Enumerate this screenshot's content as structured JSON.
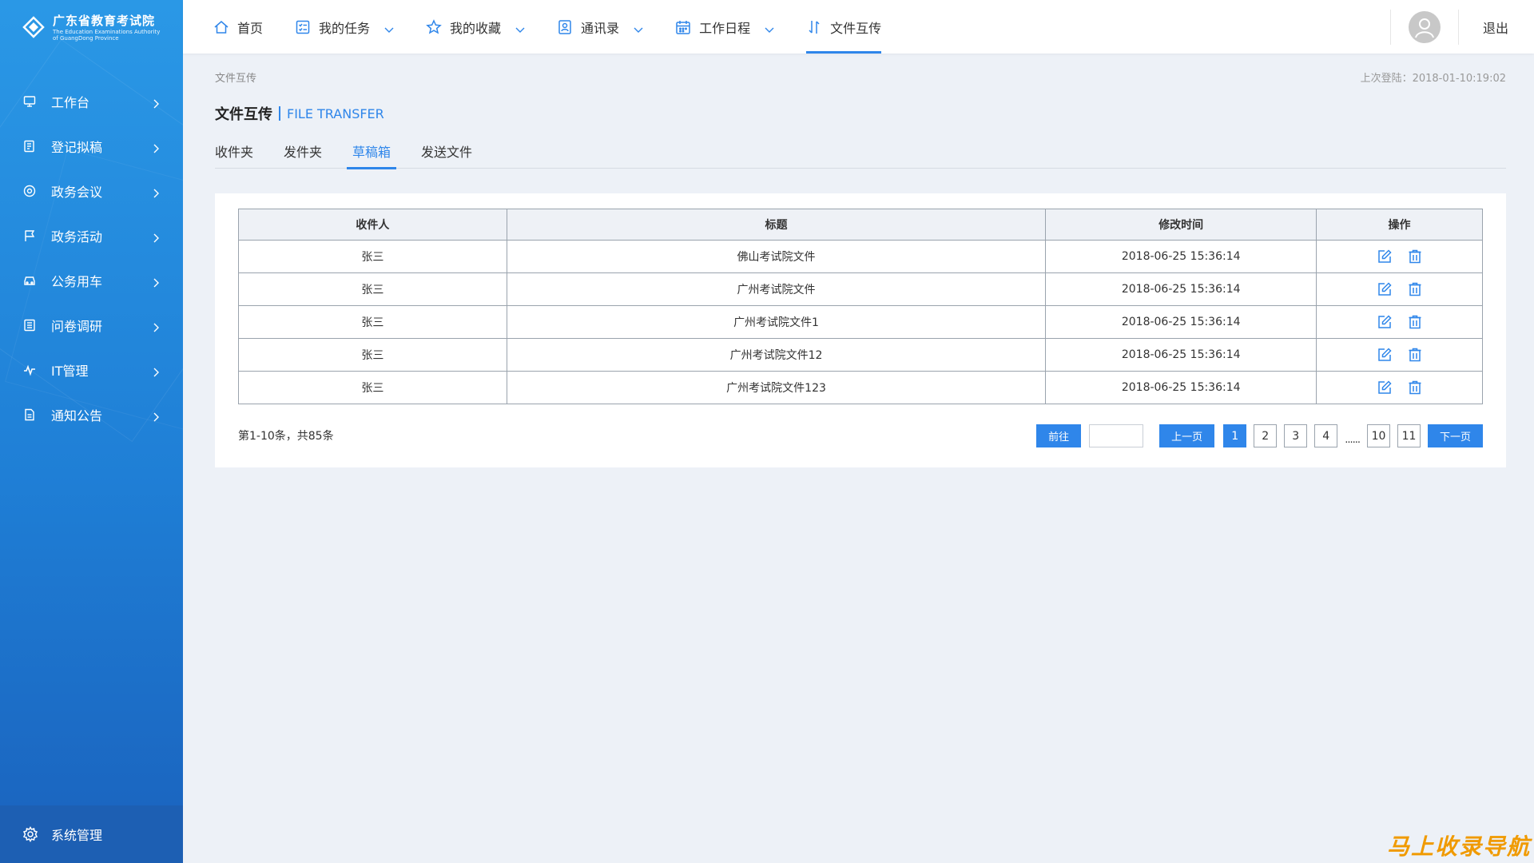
{
  "app": {
    "org_name_cn": "广东省教育考试院",
    "org_name_en": "The Education Examinations Authority of GuangDong Province"
  },
  "sidebar": {
    "items": [
      {
        "label": "工作台",
        "icon": "monitor-icon"
      },
      {
        "label": "登记拟稿",
        "icon": "edit-doc-icon"
      },
      {
        "label": "政务会议",
        "icon": "target-icon"
      },
      {
        "label": "政务活动",
        "icon": "flag-icon"
      },
      {
        "label": "公务用车",
        "icon": "car-icon"
      },
      {
        "label": "问卷调研",
        "icon": "survey-icon"
      },
      {
        "label": "IT管理",
        "icon": "network-icon"
      },
      {
        "label": "通知公告",
        "icon": "notice-icon"
      }
    ],
    "system": {
      "label": "系统管理",
      "icon": "gear-icon"
    }
  },
  "topnav": {
    "items": [
      {
        "label": "首页",
        "icon": "home-icon"
      },
      {
        "label": "我的任务",
        "icon": "task-icon"
      },
      {
        "label": "我的收藏",
        "icon": "star-icon"
      },
      {
        "label": "通讯录",
        "icon": "contacts-icon"
      },
      {
        "label": "工作日程",
        "icon": "calendar-icon"
      },
      {
        "label": "文件互传",
        "icon": "transfer-icon"
      }
    ],
    "logout": "退出"
  },
  "main": {
    "breadcrumb": "文件互传",
    "last_login": "上次登陆：2018-01-10:19:02",
    "title_cn": "文件互传",
    "title_en": "FILE TRANSFER",
    "tabs": [
      "收件夹",
      "发件夹",
      "草稿箱",
      "发送文件"
    ],
    "active_tab": "草稿箱"
  },
  "table": {
    "headers": [
      "收件人",
      "标题",
      "修改时间",
      "操作"
    ],
    "rows": [
      {
        "recipient": "张三",
        "title": "佛山考试院文件",
        "modified": "2018-06-25 15:36:14"
      },
      {
        "recipient": "张三",
        "title": "广州考试院文件",
        "modified": "2018-06-25 15:36:14"
      },
      {
        "recipient": "张三",
        "title": "广州考试院文件1",
        "modified": "2018-06-25 15:36:14"
      },
      {
        "recipient": "张三",
        "title": "广州考试院文件12",
        "modified": "2018-06-25 15:36:14"
      },
      {
        "recipient": "张三",
        "title": "广州考试院文件123",
        "modified": "2018-06-25 15:36:14"
      }
    ]
  },
  "pagination": {
    "info": "第1-10条，共85条",
    "goto_label": "前往",
    "goto_value": "",
    "prev_label": "上一页",
    "next_label": "下一页",
    "pages": [
      "1",
      "2",
      "3",
      "4"
    ],
    "ellipsis": "......",
    "last_pages": [
      "10",
      "11"
    ],
    "current": "1"
  },
  "watermark": "马上收录导航",
  "colors": {
    "accent": "#2f86ea",
    "sidebar_top": "#2a98e6",
    "sidebar_bottom": "#1a62bd",
    "watermark": "#f09a00"
  }
}
